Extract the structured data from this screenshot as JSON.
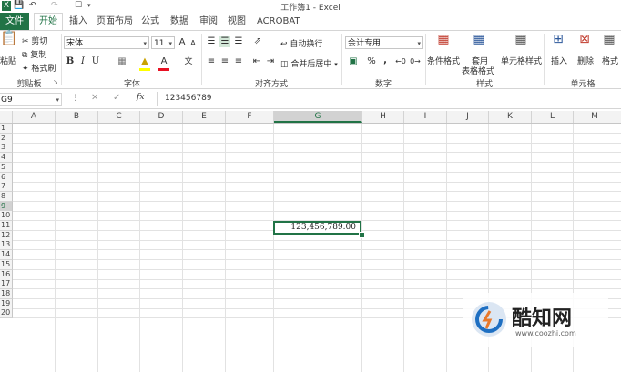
{
  "titlebar": {
    "title": "工作簿1 - Excel"
  },
  "tabs": [
    {
      "label": "文件"
    },
    {
      "label": "开始"
    },
    {
      "label": "插入"
    },
    {
      "label": "页面布局"
    },
    {
      "label": "公式"
    },
    {
      "label": "数据"
    },
    {
      "label": "审阅"
    },
    {
      "label": "视图"
    },
    {
      "label": "ACROBAT"
    }
  ],
  "ribbon": {
    "clipboard": {
      "paste": "粘贴",
      "cut": "剪切",
      "copy": "复制",
      "format_painter": "格式刷",
      "label": "剪贴板"
    },
    "font": {
      "name": "宋体",
      "size": "11",
      "grow": "A",
      "shrink": "A",
      "bold": "B",
      "italic": "I",
      "underline": "U",
      "label": "字体"
    },
    "alignment": {
      "wrap": "自动换行",
      "merge": "合并后居中",
      "label": "对齐方式"
    },
    "number": {
      "format": "会计专用",
      "percent": "%",
      "comma": ",",
      "label": "数字"
    },
    "styles": {
      "conditional": "条件格式",
      "table_line1": "套用",
      "table_line2": "表格格式",
      "cell_styles": "单元格样式",
      "label": "样式"
    },
    "cells": {
      "insert": "插入",
      "delete": "删除",
      "format": "格式",
      "label": "单元格"
    }
  },
  "formula_bar": {
    "name_box": "G9",
    "fx": "fx",
    "value": "123456789"
  },
  "columns": [
    "A",
    "B",
    "C",
    "D",
    "E",
    "F",
    "G",
    "H",
    "I",
    "J",
    "K",
    "L",
    "M"
  ],
  "rows": [
    "1",
    "2",
    "3",
    "4",
    "5",
    "6",
    "7",
    "8",
    "9",
    "10",
    "11",
    "12",
    "13",
    "14",
    "15",
    "16",
    "17",
    "18",
    "19",
    "20"
  ],
  "cell_g9": {
    "display": "123,456,789.00"
  },
  "watermark": {
    "brand": "酷知网",
    "url": "www.coozhi.com"
  },
  "colors": {
    "accent": "#217346"
  }
}
